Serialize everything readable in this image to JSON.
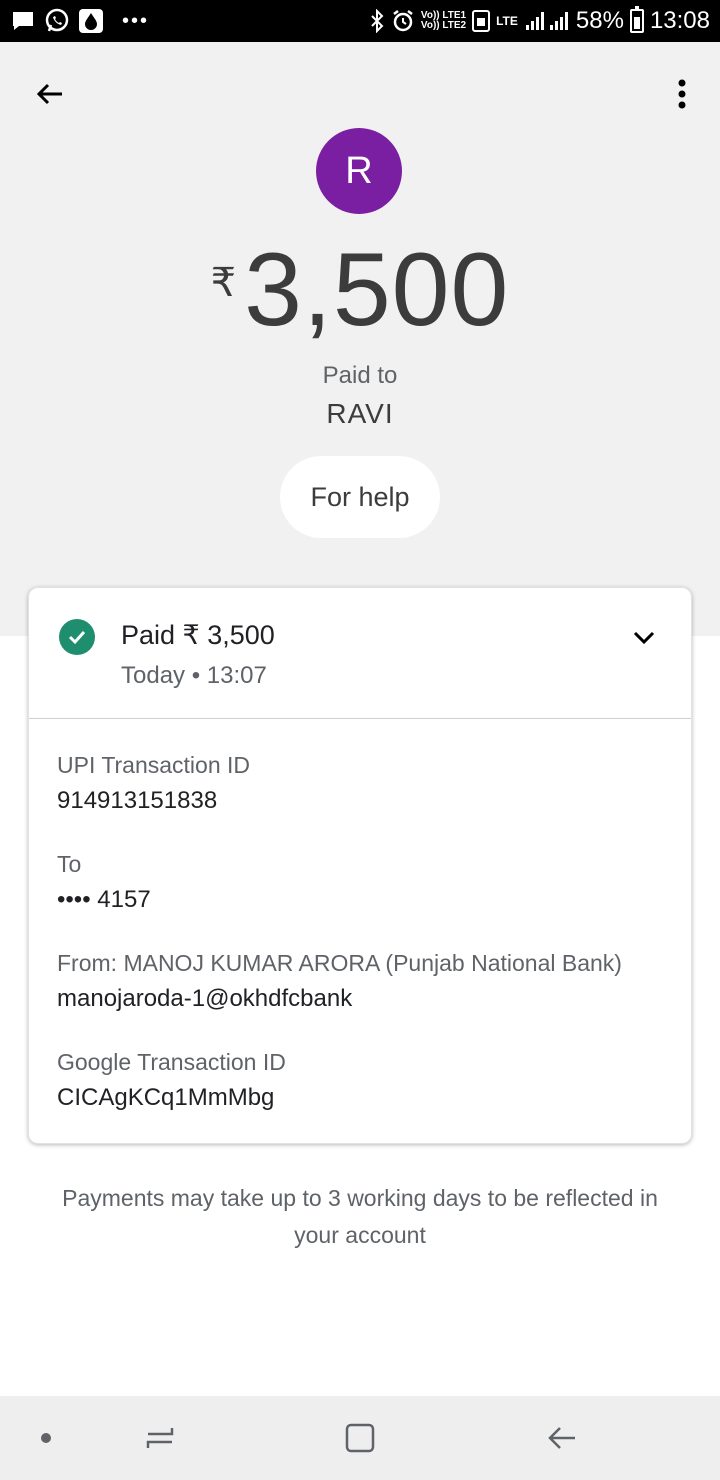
{
  "status_bar": {
    "time": "13:08",
    "battery": "58%",
    "network_label": "LTE",
    "sim1": "Vo)) LTE1",
    "sim2": "Vo)) LTE2",
    "notification_dots": "•••"
  },
  "payment": {
    "avatar_letter": "R",
    "currency_symbol": "₹",
    "amount": "3,500",
    "paid_to_label": "Paid to",
    "payee_name": "RAVI",
    "help_label": "For help"
  },
  "card": {
    "status_text": "Paid ₹ 3,500",
    "date_time": "Today • 13:07",
    "details": [
      {
        "label": "UPI Transaction ID",
        "value": "914913151838"
      },
      {
        "label": "To",
        "value": "•••• 4157"
      },
      {
        "label": "From: MANOJ KUMAR ARORA (Punjab National Bank)",
        "value": "manojaroda-1@okhdfcbank"
      },
      {
        "label": "Google Transaction ID",
        "value": "CICAgKCq1MmMbg"
      }
    ]
  },
  "footer_note": "Payments may take up to 3 working days to be reflected in your account",
  "colors": {
    "avatar": "#7b1fa2",
    "success": "#1e8e6e",
    "hero_bg": "#f1f1f1"
  },
  "icons": [
    "back-arrow-icon",
    "more-vert-icon",
    "check-circle-icon",
    "chevron-down-icon",
    "nav-dot-icon",
    "recent-apps-icon",
    "home-square-icon",
    "nav-back-icon"
  ]
}
